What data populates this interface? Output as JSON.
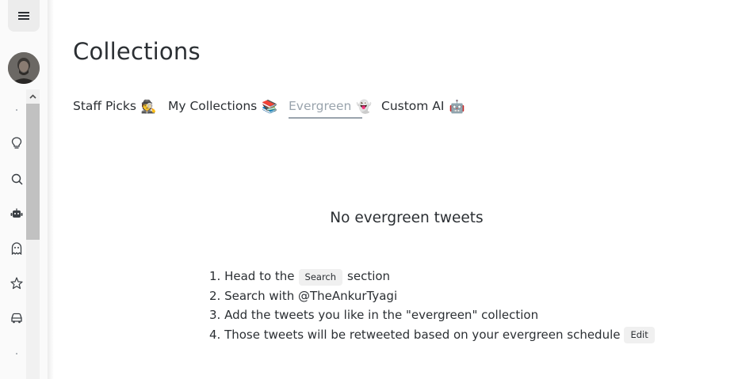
{
  "page": {
    "title": "Collections"
  },
  "tabs": [
    {
      "label": "Staff Picks",
      "emoji": "🕵️",
      "active": false
    },
    {
      "label": "My Collections",
      "emoji": "📚",
      "active": false
    },
    {
      "label": "Evergreen",
      "emoji": "👻",
      "active": true
    },
    {
      "label": "Custom AI",
      "emoji": "🤖",
      "active": false
    }
  ],
  "empty_state": {
    "title": "No evergreen tweets",
    "steps": {
      "s1_prefix": "1. Head to the",
      "s1_chip": "Search",
      "s1_suffix": "section",
      "s2": "2. Search with @TheAnkurTyagi",
      "s3": "3. Add the tweets you like in the \"evergreen\" collection",
      "s4_prefix": "4. Those tweets will be retweeted based on your evergreen schedule",
      "s4_chip": "Edit"
    }
  },
  "sidebar": {
    "icons": [
      "menu-icon",
      "lightbulb-icon",
      "search-icon",
      "robot-icon",
      "ghost-icon",
      "star-icon",
      "car-icon"
    ]
  },
  "colors": {
    "text": "#2b2f33",
    "active_tab": "#9aa4ad",
    "chip_bg": "#f0f0f0",
    "sidebar_bg": "#fafafa",
    "scroll_thumb": "#c1c1c1"
  }
}
